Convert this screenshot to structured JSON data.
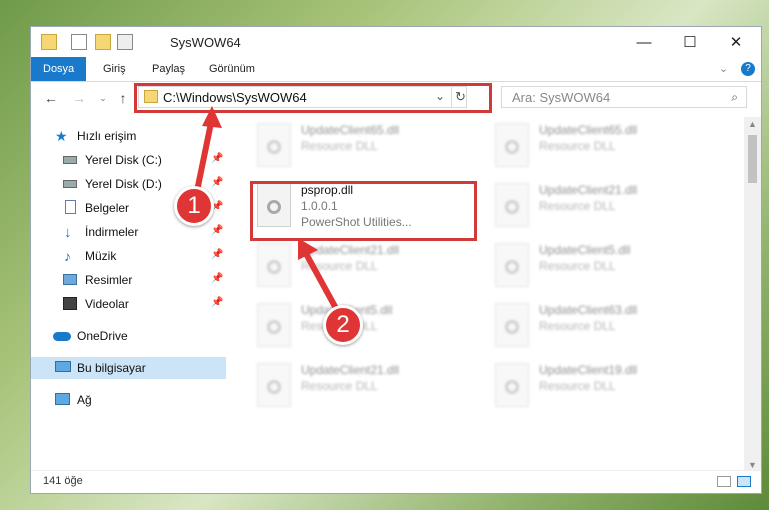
{
  "window": {
    "title": "SysWOW64",
    "controls": {
      "minimize": "—",
      "maximize": "☐",
      "close": "✕"
    }
  },
  "ribbon": {
    "tabs": [
      "Dosya",
      "Giriş",
      "Paylaş",
      "Görünüm"
    ],
    "active_tab": "Dosya"
  },
  "address_bar": {
    "path": "C:\\Windows\\SysWOW64",
    "search_placeholder": "Ara: SysWOW64"
  },
  "sidebar": {
    "quick_access": "Hızlı erişim",
    "items": [
      {
        "label": "Yerel Disk (C:)",
        "icon": "drive-icon",
        "pinned": true
      },
      {
        "label": "Yerel Disk (D:)",
        "icon": "drive-icon",
        "pinned": true
      },
      {
        "label": "Belgeler",
        "icon": "documents-icon",
        "pinned": true
      },
      {
        "label": "İndirmeler",
        "icon": "downloads-icon",
        "pinned": true
      },
      {
        "label": "Müzik",
        "icon": "music-icon",
        "pinned": true
      },
      {
        "label": "Resimler",
        "icon": "pictures-icon",
        "pinned": true
      },
      {
        "label": "Videolar",
        "icon": "videos-icon",
        "pinned": true
      }
    ],
    "onedrive": "OneDrive",
    "this_pc": "Bu bilgisayar",
    "network": "Ağ"
  },
  "files": {
    "left_column": [
      {
        "name": "UpdateClient65.dll",
        "type": "Resource DLL"
      },
      {
        "name": "psprop.dll",
        "version": "1.0.0.1",
        "description": "PowerShot Utilities..."
      },
      {
        "name": "UpdateClient21.dll",
        "type": "Resource DLL"
      },
      {
        "name": "UpdateClient5.dll",
        "type": "Resource DLL"
      },
      {
        "name": "UpdateClient21.dll",
        "type": "Resource DLL"
      }
    ],
    "right_column": [
      {
        "name": "UpdateClient65.dll",
        "type": "Resource DLL"
      },
      {
        "name": "UpdateClient21.dll",
        "type": "Resource DLL"
      },
      {
        "name": "UpdateClient5.dll",
        "type": "Resource DLL"
      },
      {
        "name": "UpdateClient63.dll",
        "type": "Resource DLL"
      },
      {
        "name": "UpdateClient19.dll",
        "type": "Resource DLL"
      }
    ]
  },
  "status": {
    "count": "141 öğe"
  },
  "annotations": {
    "step1": "1",
    "step2": "2",
    "color": "#e03535"
  }
}
